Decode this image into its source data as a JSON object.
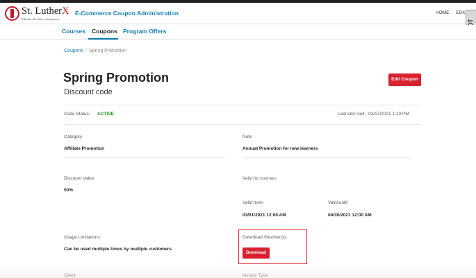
{
  "header": {
    "logo_name": "St. Luther",
    "logo_accent": "X",
    "logo_tagline": "Educate the class of tomorrow",
    "app_title": "E-Commerce Coupon Administration",
    "nav": {
      "home": "HOME",
      "edx": "EDX"
    },
    "debug_tab": "DjDT"
  },
  "tabs": [
    {
      "label": "Courses",
      "active": false
    },
    {
      "label": "Coupons",
      "active": true
    },
    {
      "label": "Program Offers",
      "active": false
    }
  ],
  "breadcrumb": {
    "parent": "Coupons",
    "separator": "/",
    "current": "Spring Promotion"
  },
  "coupon": {
    "title": "Spring Promotion",
    "subtitle": "Discount code",
    "edit_label": "Edit Coupon",
    "status_label": "Code Status:",
    "status_value": "ACTIVE",
    "last_edit": "Last edit: null - 03/17/2021 1:10 PM"
  },
  "fields": {
    "category": {
      "label": "Category",
      "value": "Affiliate Promotion"
    },
    "note": {
      "label": "Note",
      "value": "Annual Promotion for new learners"
    },
    "discount_value": {
      "label": "Discount Value:",
      "value": "50%"
    },
    "valid_for_courses": {
      "label": "Valid for courses:",
      "value": ""
    },
    "valid_from": {
      "label": "Valid from:",
      "value": "03/01/2021 12:00 AM"
    },
    "valid_until": {
      "label": "Valid until:",
      "value": "04/30/2021 12:00 AM"
    },
    "usage_limitations": {
      "label": "Usage Limitations:",
      "value": "Can be used multiple times by multiple customers"
    },
    "download_vouchers": {
      "label": "Download Voucher(s):",
      "button": "Download"
    }
  },
  "cutoff_labels": {
    "left": "Client",
    "right": "Invoice Type"
  },
  "colors": {
    "brand_red": "#d7212f",
    "link_blue": "#0f7fb0",
    "active_green": "#1e8a1e"
  }
}
